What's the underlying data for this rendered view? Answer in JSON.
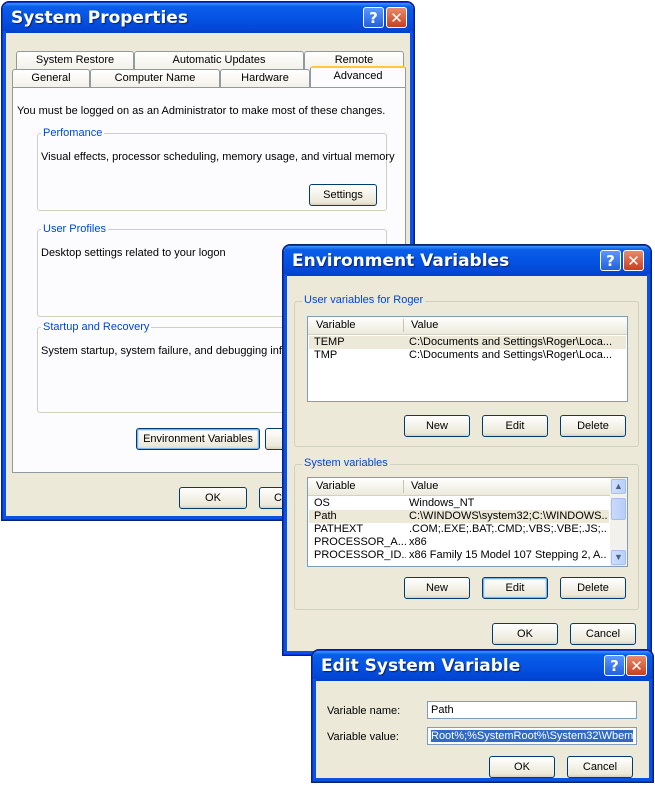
{
  "system_properties": {
    "title": "System Properties",
    "tabs_row1": [
      "System Restore",
      "Automatic Updates",
      "Remote"
    ],
    "tabs_row2": [
      "General",
      "Computer Name",
      "Hardware",
      "Advanced"
    ],
    "active_tab": "Advanced",
    "admin_note": "You must be logged on as an Administrator to make most of these changes.",
    "performance": {
      "legend": "Perfomance",
      "desc": "Visual effects, processor scheduling, memory usage, and virtual memory",
      "button": "Settings"
    },
    "user_profiles": {
      "legend": "User Profiles",
      "desc": "Desktop settings related to your logon"
    },
    "startup": {
      "legend": "Startup and Recovery",
      "desc": "System startup, system failure, and debugging information"
    },
    "env_button": "Environment Variables",
    "ok": "OK",
    "cancel_partial": "C"
  },
  "environment_variables": {
    "title": "Environment Variables",
    "user_group_label": "User variables for Roger",
    "columns": [
      "Variable",
      "Value"
    ],
    "user_rows": [
      {
        "variable": "TEMP",
        "value": "C:\\Documents and Settings\\Roger\\Loca..."
      },
      {
        "variable": "TMP",
        "value": "C:\\Documents and Settings\\Roger\\Loca..."
      }
    ],
    "system_group_label": "System variables",
    "system_rows": [
      {
        "variable": "OS",
        "value": "Windows_NT"
      },
      {
        "variable": "Path",
        "value": "C:\\WINDOWS\\system32;C:\\WINDOWS..."
      },
      {
        "variable": "PATHEXT",
        "value": ".COM;.EXE;.BAT;.CMD;.VBS;.VBE;.JS;...."
      },
      {
        "variable": "PROCESSOR_A...",
        "value": "x86"
      },
      {
        "variable": "PROCESSOR_ID...",
        "value": "x86 Family 15 Model 107 Stepping 2, A..."
      }
    ],
    "new": "New",
    "edit": "Edit",
    "delete": "Delete",
    "ok": "OK",
    "cancel": "Cancel"
  },
  "edit_system_variable": {
    "title": "Edit System Variable",
    "name_label": "Variable name:",
    "value_label": "Variable value:",
    "name_value": "Path",
    "value_value": "Root%;%SystemRoot%\\System32\\Wbem",
    "ok": "OK",
    "cancel": "Cancel"
  },
  "colors": {
    "title_blue": "#0553e4",
    "face": "#ece9d8",
    "legend_blue": "#0046d5",
    "selection": "#316ac5"
  }
}
